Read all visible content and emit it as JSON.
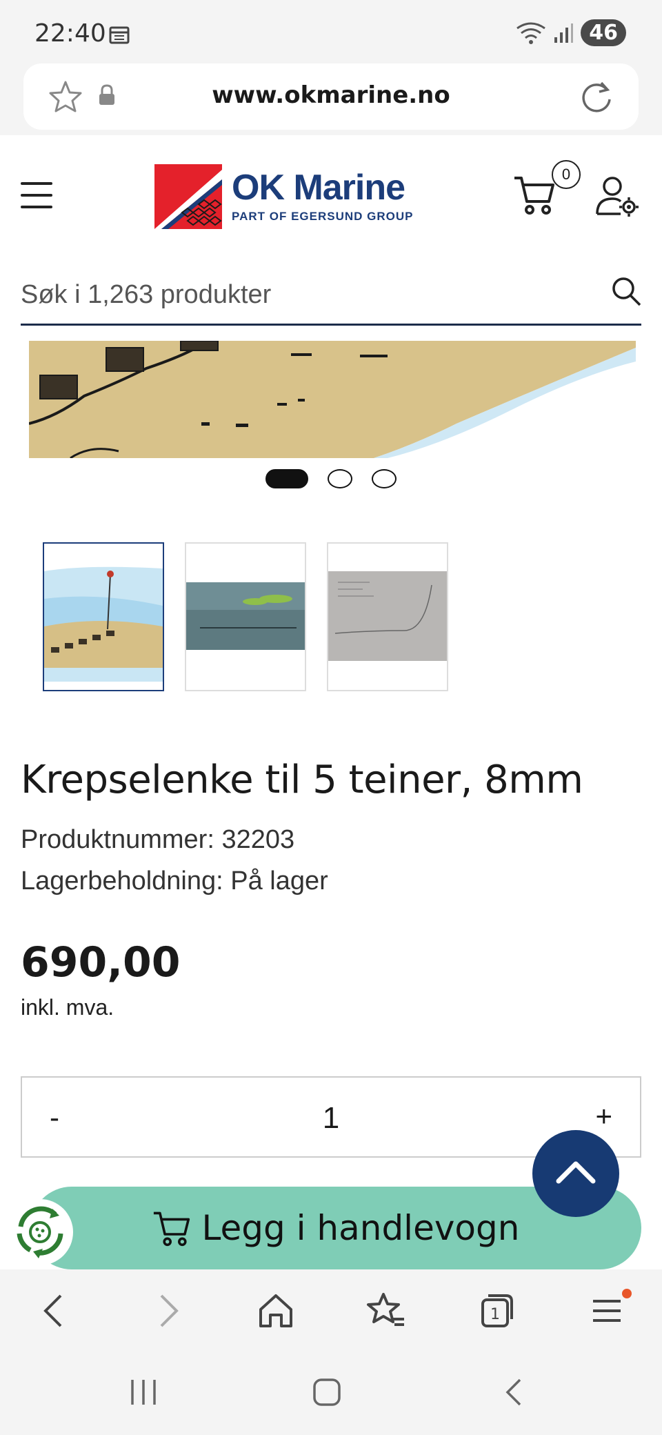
{
  "status_bar": {
    "time": "22:40",
    "battery": "46"
  },
  "browser": {
    "url": "www.okmarine.no"
  },
  "header": {
    "logo_title": "OK Marine",
    "logo_subtitle": "PART OF EGERSUND GROUP",
    "cart_count": "0"
  },
  "search": {
    "placeholder": "Søk i 1,263 produkter"
  },
  "product": {
    "title": "Krepselenke til 5 teiner, 8mm",
    "number_line": "Produktnummer: 32203",
    "stock_line": "Lagerbeholdning: På lager",
    "price": "690,00",
    "vat_label": "inkl. mva."
  },
  "quantity": {
    "minus": "-",
    "value": "1",
    "plus": "+"
  },
  "add_to_cart": {
    "label": "Legg i handlevogn"
  },
  "carousel": {
    "active_index": 0,
    "count": 3
  },
  "colors": {
    "brand": "#1c3d7a",
    "cta": "#7fcdb6",
    "scroll_top": "#173a73"
  }
}
